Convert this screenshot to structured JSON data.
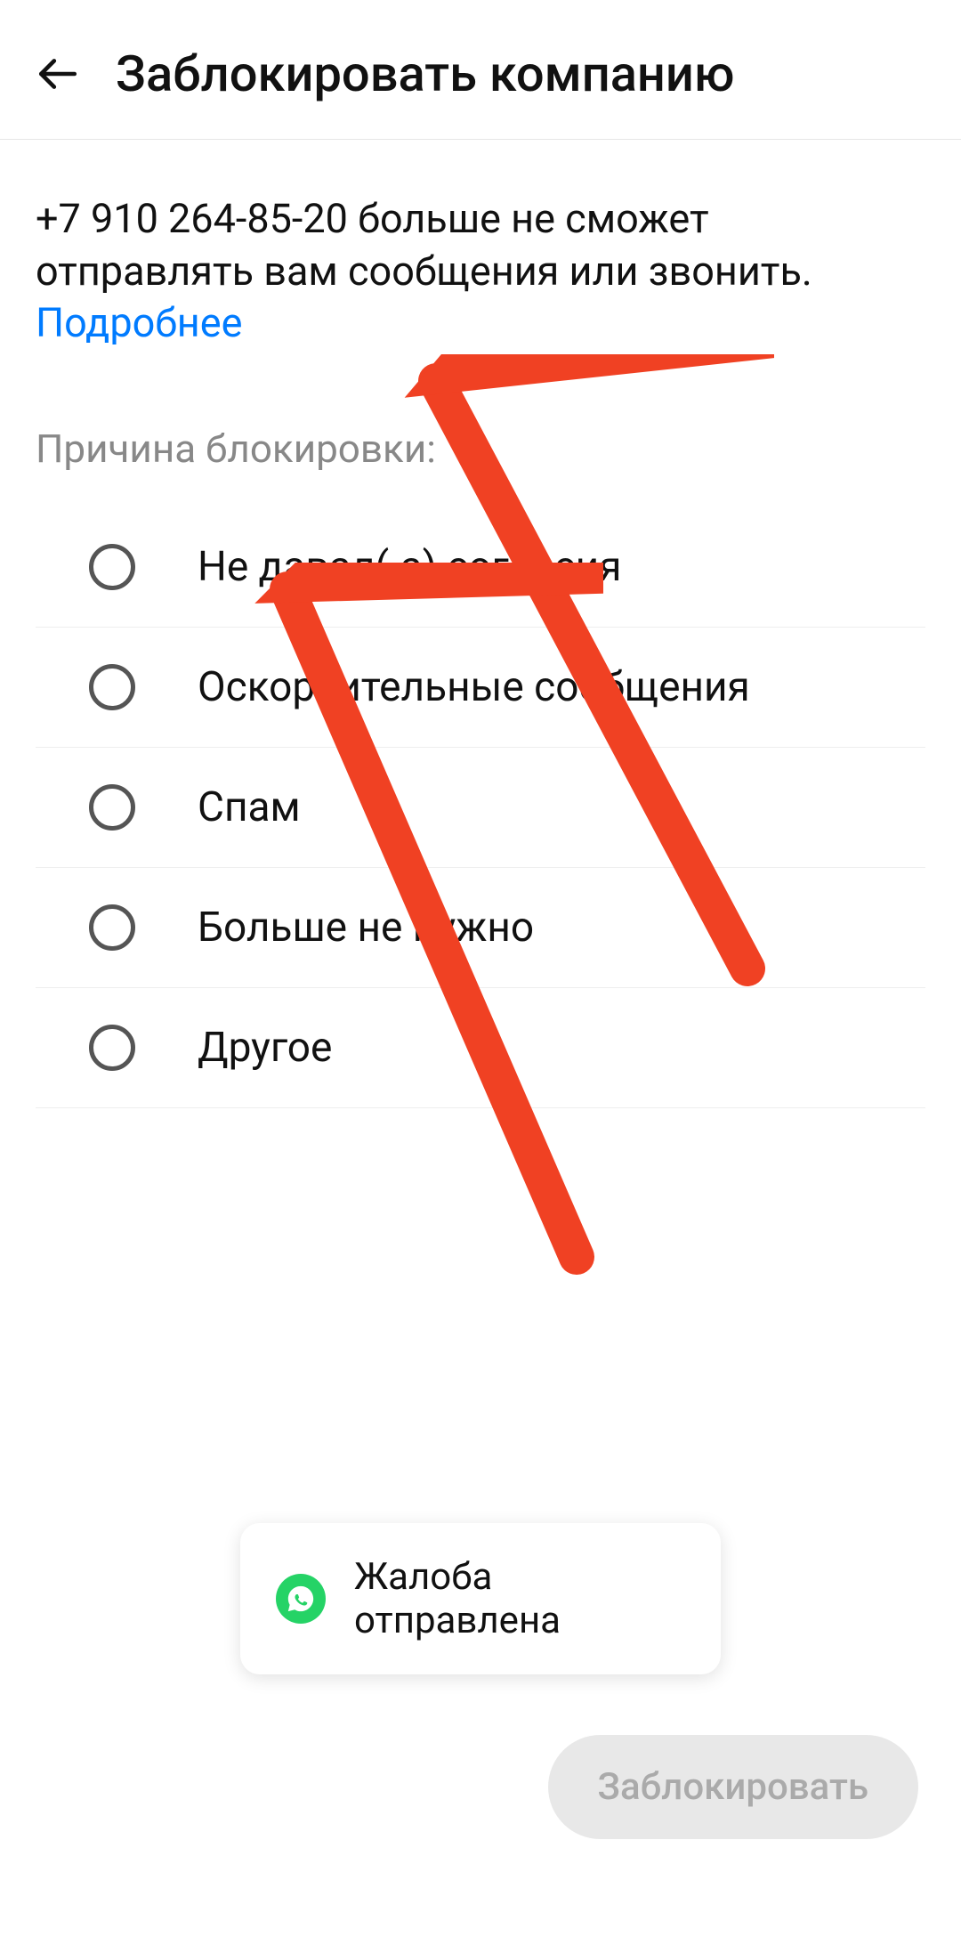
{
  "header": {
    "title": "Заблокировать компанию"
  },
  "info": {
    "text_part1": "+7 910 264-85-20 больше не сможет отправлять вам сообщения или звонить. ",
    "link": "Подробнее"
  },
  "section_label": "Причина блокировки:",
  "options": [
    {
      "label": "Не давал(-а) согласия"
    },
    {
      "label": "Оскорбительные сообщения"
    },
    {
      "label": "Спам"
    },
    {
      "label": "Больше не нужно"
    },
    {
      "label": "Другое"
    }
  ],
  "toast": {
    "text": "Жалоба отправлена"
  },
  "footer": {
    "block_button": "Заблокировать"
  }
}
